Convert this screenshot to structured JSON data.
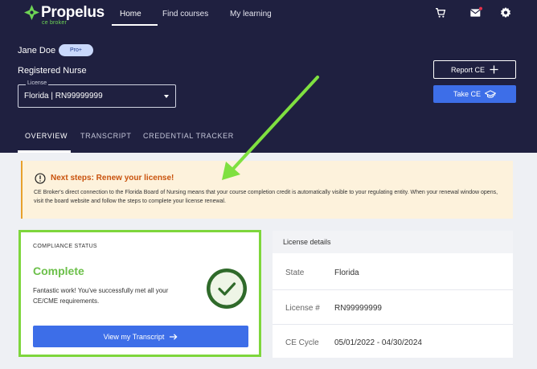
{
  "brand": {
    "name": "Propelus",
    "sub": "ce broker"
  },
  "nav": {
    "home": "Home",
    "find_courses": "Find courses",
    "my_learning": "My learning"
  },
  "header_icons": {
    "cart": "cart-icon",
    "mail": "mail-icon",
    "settings": "gear-icon"
  },
  "user": {
    "name": "Jane Doe",
    "badge": "Pro+",
    "role": "Registered Nurse"
  },
  "license_select": {
    "legend": "License",
    "value": "Florida | RN99999999"
  },
  "actions": {
    "report_ce": "Report CE",
    "take_ce": "Take CE"
  },
  "tabs": {
    "overview": "OVERVIEW",
    "transcript": "TRANSCRIPT",
    "credential_tracker": "CREDENTIAL TRACKER"
  },
  "alert": {
    "title": "Next steps: Renew your license!",
    "body": "CE Broker's direct connection to the Florida Board of Nursing means that your course completion credit is automatically visible to your regulating entity. When your renewal window opens, visit the board website and follow the steps to complete your license renewal."
  },
  "compliance": {
    "label": "COMPLIANCE STATUS",
    "status": "Complete",
    "message": "Fantastic work! You've successfully met all your CE/CME requirements.",
    "button": "View my Transcript"
  },
  "license_details": {
    "title": "License details",
    "rows": [
      {
        "label": "State",
        "value": "Florida"
      },
      {
        "label": "License #",
        "value": "RN99999999"
      },
      {
        "label": "CE Cycle",
        "value": "05/01/2022 - 04/30/2024"
      }
    ]
  },
  "colors": {
    "header": "#1f2040",
    "accent_blue": "#3d6ee8",
    "success": "#6cc04a",
    "alert_title": "#c9520c",
    "highlight": "#7ed63c"
  }
}
